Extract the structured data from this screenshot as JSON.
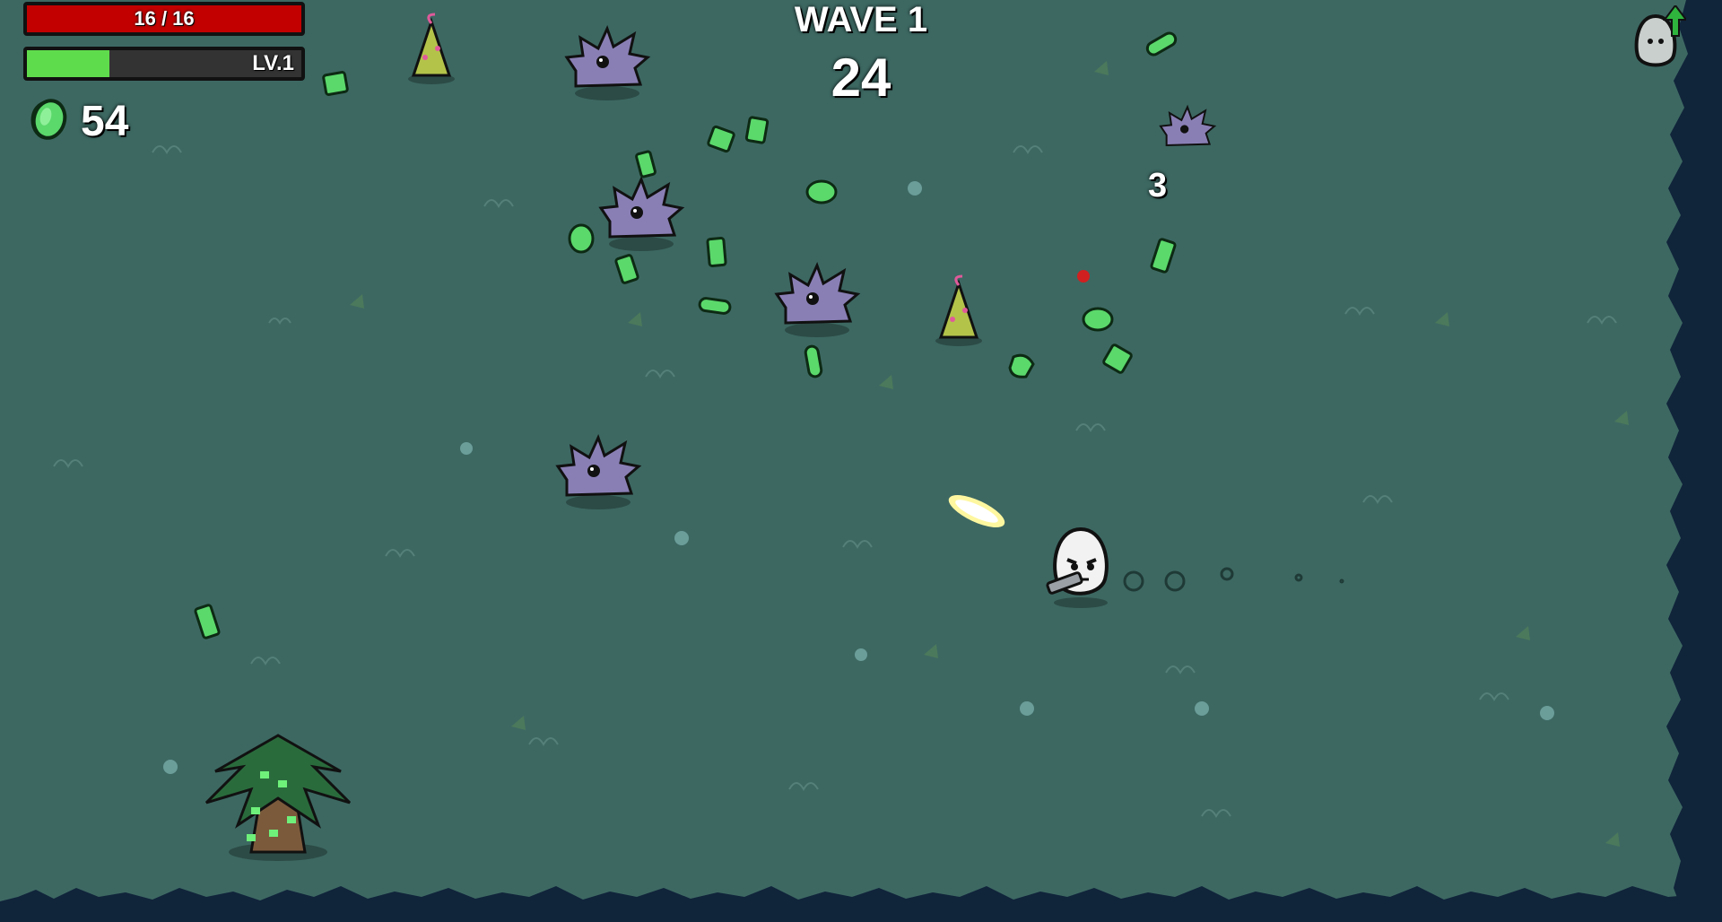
{
  "hud": {
    "health_text": "16 / 16",
    "health_fraction": 1.0,
    "level_text": "LV.1",
    "xp_fraction": 0.3,
    "materials_count": "54",
    "wave_text": "WAVE 1",
    "timer_text": "24",
    "damage_popup": "3"
  },
  "colors": {
    "ground": "#3d6862",
    "health": "#c20000",
    "xp": "#5fdc4c",
    "material": "#5bd96b",
    "enemy": "#8a7fb5",
    "border": "#10243a"
  },
  "icons": {
    "materials": "material-icon",
    "level_up": "level-up-egg-icon",
    "player": "potato-player",
    "enemy": "purple-spiky-alien",
    "pickup": "material-drop"
  }
}
